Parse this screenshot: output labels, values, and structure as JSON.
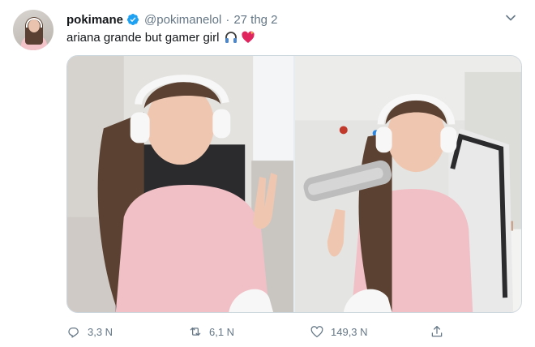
{
  "tweet": {
    "display_name": "pokimane",
    "handle": "@pokimanelol",
    "separator": "·",
    "date": "27 thg 2",
    "text": "ariana grande but gamer girl",
    "emojis": [
      "headphone-emoji",
      "sparkling-heart-emoji"
    ]
  },
  "actions": {
    "reply_count": "3,3 N",
    "retweet_count": "6,1 N",
    "like_count": "149,3 N"
  },
  "colors": {
    "text": "#14171a",
    "secondary": "#657786",
    "verified": "#1da1f2",
    "border": "#ccd6dd"
  },
  "icons": [
    "caret-down-icon",
    "verified-badge-icon",
    "reply-icon",
    "retweet-icon",
    "like-icon",
    "share-icon"
  ]
}
